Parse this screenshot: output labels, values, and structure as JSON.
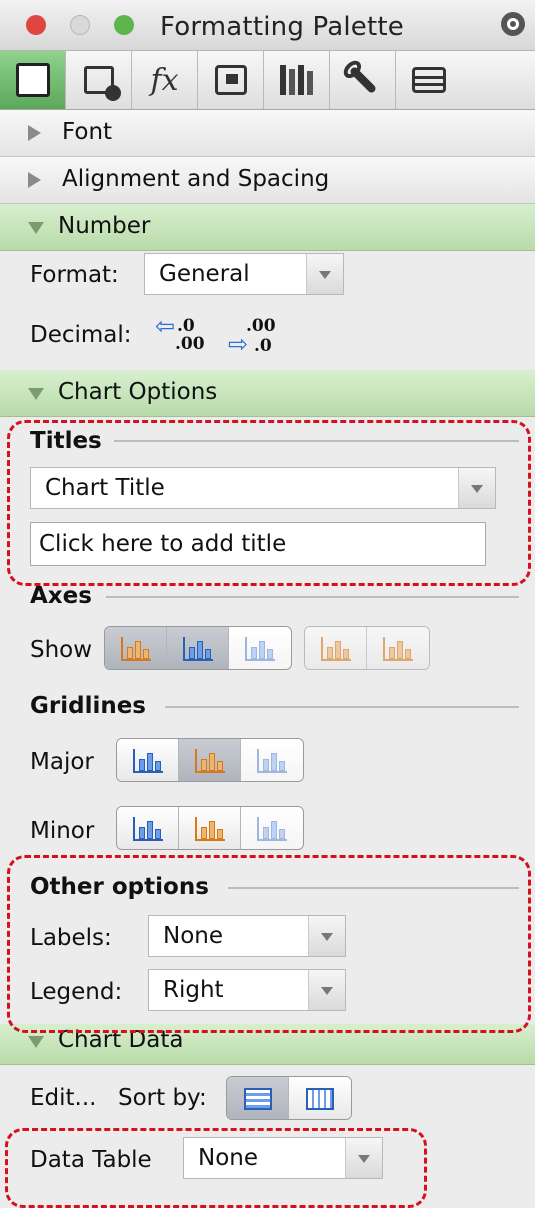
{
  "window": {
    "title": "Formatting Palette",
    "traffic_colors": [
      "#e0463f",
      "#d9d9d9",
      "#5fb54d"
    ]
  },
  "toolbar": {
    "fx_label": "fx",
    "icons": [
      "formatting-icon",
      "object-icon",
      "formula-icon",
      "gallery-icon",
      "library-icon",
      "tools-icon",
      "briefcase-icon"
    ]
  },
  "sections": {
    "font": "Font",
    "alignment": "Alignment and Spacing",
    "number": "Number",
    "chart_options": "Chart Options",
    "chart_data": "Chart Data"
  },
  "number": {
    "format_label": "Format:",
    "format_value": "General",
    "decimal_label": "Decimal:",
    "dec_a_top": ".0",
    "dec_a_bottom": ".00",
    "dec_b_top": ".00",
    "dec_b_bottom": ".0"
  },
  "chart_options": {
    "titles_heading": "Titles",
    "titles_select": "Chart Title",
    "title_input_value": "Click here to add title",
    "axes_heading": "Axes",
    "show_label": "Show",
    "gridlines_heading": "Gridlines",
    "major_label": "Major",
    "minor_label": "Minor",
    "other_heading": "Other options",
    "labels_label": "Labels:",
    "labels_value": "None",
    "legend_label": "Legend:",
    "legend_value": "Right"
  },
  "chart_data": {
    "edit_label": "Edit...",
    "sort_label": "Sort by:",
    "data_table_label": "Data Table",
    "data_table_value": "None"
  },
  "accent": {
    "highlight_dash": "#d6101d",
    "section_green": "#b8dba9"
  }
}
